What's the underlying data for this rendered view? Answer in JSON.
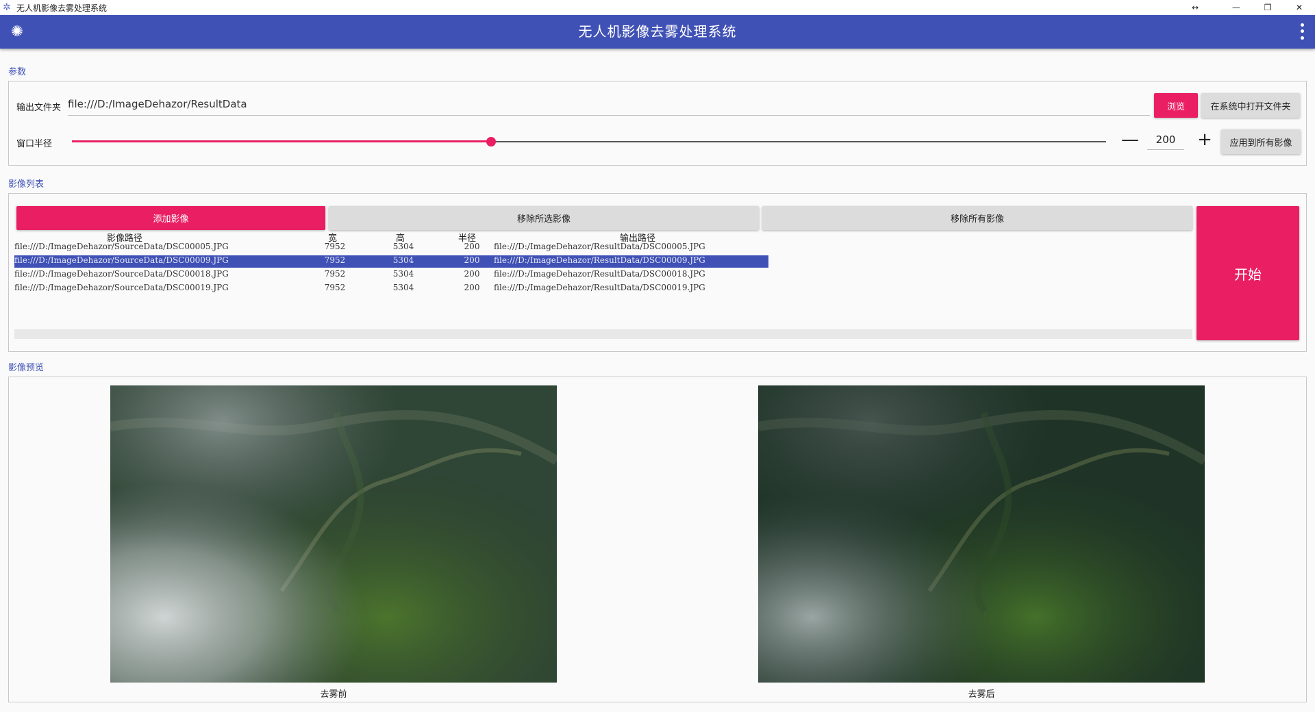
{
  "window": {
    "title": "无人机影像去雾处理系统"
  },
  "appbar": {
    "title": "无人机影像去雾处理系统"
  },
  "params": {
    "section_label": "参数",
    "output_label": "输出文件夹",
    "output_value": "file:///D:/ImageDehazor/ResultData",
    "browse_label": "浏览",
    "open_in_system_label": "在系统中打开文件夹",
    "radius_label": "窗口半径",
    "radius_value": "200",
    "radius_slider_fraction": 0.405,
    "minus_label": "—",
    "plus_label": "+",
    "apply_all_label": "应用到所有影像"
  },
  "image_list": {
    "section_label": "影像列表",
    "add_label": "添加影像",
    "remove_selected_label": "移除所选影像",
    "remove_all_label": "移除所有影像",
    "start_label": "开始",
    "columns": [
      "影像路径",
      "宽",
      "高",
      "半径",
      "输出路径"
    ],
    "rows": [
      [
        "file:///D:/ImageDehazor/SourceData/DSC00005.JPG",
        "7952",
        "5304",
        "200",
        "file:///D:/ImageDehazor/ResultData/DSC00005.JPG"
      ],
      [
        "file:///D:/ImageDehazor/SourceData/DSC00009.JPG",
        "7952",
        "5304",
        "200",
        "file:///D:/ImageDehazor/ResultData/DSC00009.JPG"
      ],
      [
        "file:///D:/ImageDehazor/SourceData/DSC00018.JPG",
        "7952",
        "5304",
        "200",
        "file:///D:/ImageDehazor/ResultData/DSC00018.JPG"
      ],
      [
        "file:///D:/ImageDehazor/SourceData/DSC00019.JPG",
        "7952",
        "5304",
        "200",
        "file:///D:/ImageDehazor/ResultData/DSC00019.JPG"
      ]
    ],
    "selected_row": 1
  },
  "preview": {
    "section_label": "影像预览",
    "before_caption": "去雾前",
    "after_caption": "去雾后"
  },
  "colors": {
    "primary": "#3f51b5",
    "accent": "#e91e63"
  }
}
